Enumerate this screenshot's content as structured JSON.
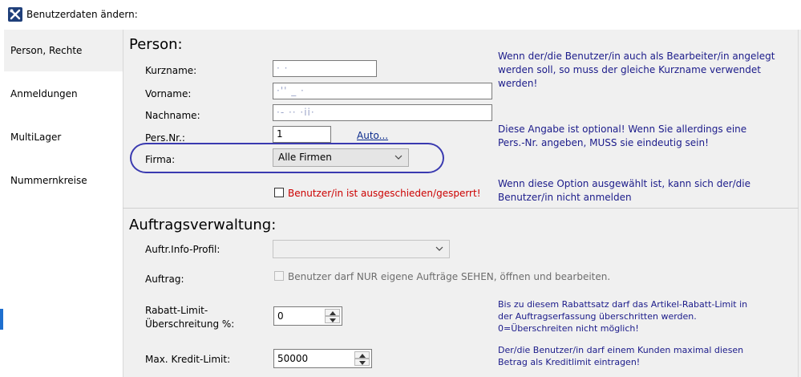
{
  "window": {
    "title": "Benutzerdaten ändern:"
  },
  "nav": {
    "items": [
      {
        "label": "Person, Rechte",
        "active": true
      },
      {
        "label": "Anmeldungen",
        "active": false
      },
      {
        "label": "MultiLager",
        "active": false
      },
      {
        "label": "Nummernkreise",
        "active": false
      }
    ]
  },
  "person": {
    "title": "Person:",
    "kurzname_label": "Kurzname:",
    "kurzname_value": "· ·",
    "vorname_label": "Vorname:",
    "vorname_value": "·'' _ ·",
    "nachname_label": "Nachname:",
    "nachname_value": "·- ·· ·ii·",
    "persnr_label": "Pers.Nr.:",
    "persnr_value": "1",
    "auto_link": "Auto...",
    "firma_label": "Firma:",
    "firma_value": "Alle Firmen",
    "ausgeschieden_label": "Benutzer/in ist ausgeschieden/gesperrt!",
    "help_kurzname": [
      "Wenn der/die Benutzer/in auch als Bearbeiter/in angelegt",
      "werden soll, so muss der gleiche Kurzname verwendet werden!"
    ],
    "help_persnr": [
      "Diese Angabe ist optional! Wenn Sie allerdings eine",
      "Pers.-Nr. angeben, MUSS sie eindeutig sein!"
    ],
    "help_ausgeschieden": [
      "Wenn diese Option ausgewählt ist, kann sich der/die",
      "Benutzer/in nicht anmelden"
    ]
  },
  "auftrag": {
    "title": "Auftragsverwaltung:",
    "profil_label": "Auftr.Info-Profil:",
    "profil_value": "",
    "auftrag_label": "Auftrag:",
    "auftrag_checkbox": "Benutzer darf NUR eigene Aufträge SEHEN, öffnen und bearbeiten.",
    "rabatt_label_1": "Rabatt-Limit-",
    "rabatt_label_2": "Überschreitung %:",
    "rabatt_value": "0",
    "help_rabatt": [
      "Bis zu diesem Rabattsatz darf das Artikel-Rabatt-Limit in",
      "der Auftragserfassung überschritten werden.",
      "0=Überschreiten nicht möglich!"
    ],
    "kredit_label": "Max. Kredit-Limit:",
    "kredit_value": "50000",
    "help_kredit": [
      "Der/die Benutzer/in darf einem Kunden maximal diesen",
      "Betrag als Kreditlimit eintragen!"
    ]
  },
  "icons": {
    "app": "tools-icon",
    "dropdown": "chevron-down-icon",
    "spin_up": "arrow-up-icon",
    "spin_down": "arrow-down-icon"
  },
  "colors": {
    "help_text": "#1b1b8a",
    "warning_text": "#cc0000",
    "highlight": "#3a3ab0",
    "panel_bg": "#f0f0f0"
  }
}
